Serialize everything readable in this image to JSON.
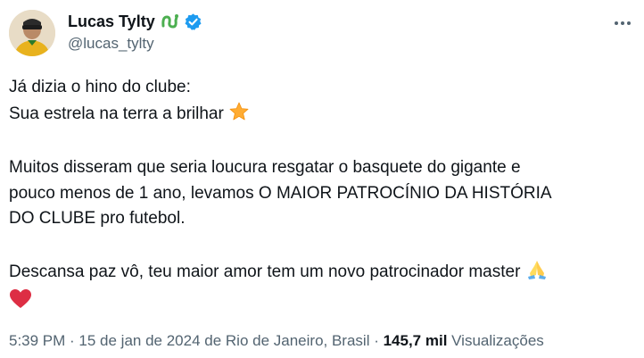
{
  "author": {
    "display_name": "Lucas Tylty",
    "handle": "@lucas_tylty"
  },
  "icons": {
    "name_badge": "green-snake-icon",
    "verified": "verified-badge-icon",
    "more": "more-horizontal-icon"
  },
  "colors": {
    "verified": "#1d9bf0",
    "secondary_text": "#536471",
    "primary_text": "#0f1419",
    "badge_green": "#4caf50"
  },
  "tweet": {
    "lines": {
      "l1": "Já dizia o hino do clube:",
      "l2": "Sua estrela na terra a brilhar",
      "p2_l1": "Muitos disseram que seria loucura resgatar o basquete do gigante e",
      "p2_l2": "pouco menos de 1 ano, levamos O MAIOR PATROCÍNIO DA HISTÓRIA",
      "p2_l3": "DO CLUBE pro futebol.",
      "p3_l1": "Descansa paz vô, teu maior amor tem um novo patrocinador master"
    },
    "emojis": {
      "star": "star-emoji",
      "pray": "folded-hands-emoji",
      "heart": "red-heart-emoji"
    }
  },
  "meta": {
    "time": "5:39 PM",
    "sep1": " · ",
    "date": "15 de jan de 2024 de Rio de Janeiro, Brasil",
    "sep2": " · ",
    "views_count": "145,7 mil",
    "views_label": " Visualizações"
  }
}
